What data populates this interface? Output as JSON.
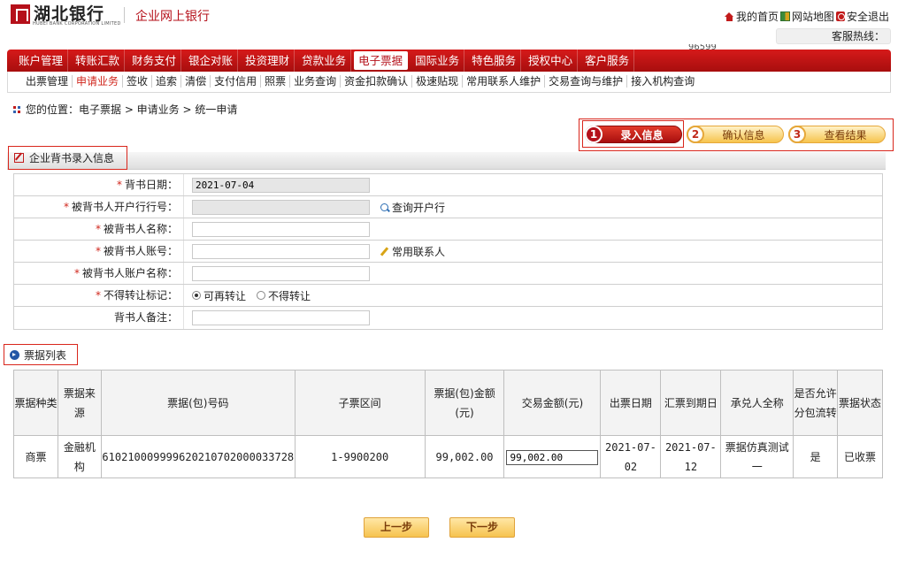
{
  "header": {
    "bank_name": "湖北银行",
    "bank_name_en": "HUBEI BANK CORPORATION LIMITED",
    "product_title": "企业网上银行",
    "links": {
      "home": "我的首页",
      "sitemap": "网站地图",
      "logout": "安全退出"
    },
    "hotline_label": "客服热线：",
    "hotline_number_partial": "96599"
  },
  "nav": {
    "items": [
      "账户管理",
      "转账汇款",
      "财务支付",
      "银企对账",
      "投资理财",
      "贷款业务",
      "电子票据",
      "国际业务",
      "特色服务",
      "授权中心",
      "客户服务"
    ],
    "active": "电子票据"
  },
  "subnav": {
    "items": [
      "出票管理",
      "申请业务",
      "签收",
      "追索",
      "清偿",
      "支付信用",
      "照票",
      "业务查询",
      "资金扣款确认",
      "极速贴现",
      "常用联系人维护",
      "交易查询与维护",
      "接入机构查询"
    ],
    "active": "申请业务"
  },
  "breadcrumb": {
    "text": "您的位置：电子票据 > 申请业务 > 统一申请"
  },
  "steps": [
    {
      "num": "1",
      "label": "录入信息",
      "state": "active"
    },
    {
      "num": "2",
      "label": "确认信息",
      "state": "pending"
    },
    {
      "num": "3",
      "label": "查看结果",
      "state": "pending"
    }
  ],
  "section": {
    "title": "企业背书录入信息"
  },
  "form": {
    "endorse_date": {
      "label": "背书日期：",
      "value": "2021-07-04"
    },
    "bank_no": {
      "label": "被背书人开户行行号：",
      "value": "",
      "action": "查询开户行"
    },
    "name": {
      "label": "被背书人名称：",
      "value": ""
    },
    "account": {
      "label": "被背书人账号：",
      "value": "",
      "action": "常用联系人"
    },
    "account_name": {
      "label": "被背书人账户名称：",
      "value": ""
    },
    "transfer_flag": {
      "label": "不得转让标记：",
      "option_on": "可再转让",
      "option_off": "不得转让"
    },
    "remark": {
      "label": "背书人备注：",
      "value": ""
    },
    "required_mark": "*"
  },
  "list": {
    "title": "票据列表",
    "columns": [
      "票据种类",
      "票据来源",
      "票据(包)号码",
      "子票区间",
      "票据(包)金额(元)",
      "交易金额(元)",
      "出票日期",
      "汇票到期日",
      "承兑人全称",
      "是否允许分包流转",
      "票据状态"
    ],
    "rows": [
      {
        "kind": "商票",
        "source": "金融机构",
        "number": "610210009999620210702000033728",
        "range": "1-9900200",
        "amount": "99,002.00",
        "trade_amount": "99,002.00",
        "issue_date": "2021-07-02",
        "due_date": "2021-07-12",
        "acceptor": "票据仿真测试一",
        "split": "是",
        "status": "已收票"
      }
    ]
  },
  "buttons": {
    "prev": "上一步",
    "next": "下一步"
  },
  "colors": {
    "brand_red": "#b5101a",
    "accent_orange": "#f6c34f",
    "required_red": "#d0261c"
  }
}
